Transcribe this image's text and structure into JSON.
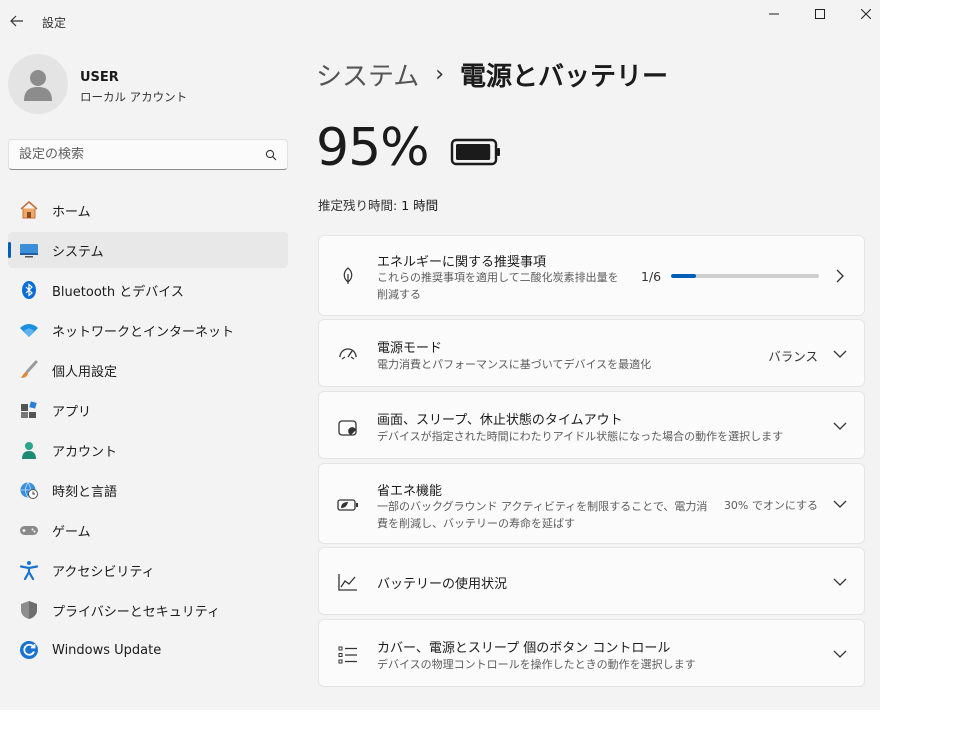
{
  "app": {
    "title": "設定"
  },
  "user": {
    "name": "USER",
    "account_type": "ローカル アカウント"
  },
  "search": {
    "placeholder": "設定の検索"
  },
  "nav": [
    {
      "label": "ホーム",
      "icon": "home-icon",
      "active": false
    },
    {
      "label": "システム",
      "icon": "system-display-icon",
      "active": true
    },
    {
      "label": "Bluetooth とデバイス",
      "icon": "bluetooth-icon",
      "active": false
    },
    {
      "label": "ネットワークとインターネット",
      "icon": "wifi-icon",
      "active": false
    },
    {
      "label": "個人用設定",
      "icon": "paintbrush-icon",
      "active": false
    },
    {
      "label": "アプリ",
      "icon": "apps-icon",
      "active": false
    },
    {
      "label": "アカウント",
      "icon": "person-icon",
      "active": false
    },
    {
      "label": "時刻と言語",
      "icon": "globe-clock-icon",
      "active": false
    },
    {
      "label": "ゲーム",
      "icon": "gamepad-icon",
      "active": false
    },
    {
      "label": "アクセシビリティ",
      "icon": "accessibility-icon",
      "active": false
    },
    {
      "label": "プライバシーとセキュリティ",
      "icon": "shield-icon",
      "active": false
    },
    {
      "label": "Windows Update",
      "icon": "windows-update-icon",
      "active": false
    }
  ],
  "breadcrumb": {
    "parent": "システム",
    "separator": "›",
    "current": "電源とバッテリー"
  },
  "battery": {
    "percent": "95%",
    "level": 0.95,
    "estimate_label": "推定残り時間:",
    "estimate_value": "1 時間"
  },
  "cards": {
    "energy": {
      "title": "エネルギーに関する推奨事項",
      "desc": "これらの推奨事項を適用して二酸化炭素排出量を削減する",
      "count": "1/6",
      "progress": 0.1667
    },
    "power_mode": {
      "title": "電源モード",
      "desc": "電力消費とパフォーマンスに基づいてデバイスを最適化",
      "value": "バランス"
    },
    "screen_sleep": {
      "title": "画面、スリープ、休止状態のタイムアウト",
      "desc": "デバイスが指定された時間にわたりアイドル状態になった場合の動作を選択します"
    },
    "energy_saver": {
      "title": "省エネ機能",
      "desc": "一部のバックグラウンド アクティビティを制限することで、電力消費を削減し、バッテリーの寿命を延ばす",
      "value": "30% でオンにする"
    },
    "battery_usage": {
      "title": "バッテリーの使用状況"
    },
    "lid_power": {
      "title": "カバー、電源とスリープ 個のボタン コントロール",
      "desc": "デバイスの物理コントロールを操作したときの動作を選択します"
    }
  },
  "colors": {
    "accent": "#005fb8",
    "window_bg": "#f3f3f3",
    "card_bg": "#fbfbfb"
  }
}
